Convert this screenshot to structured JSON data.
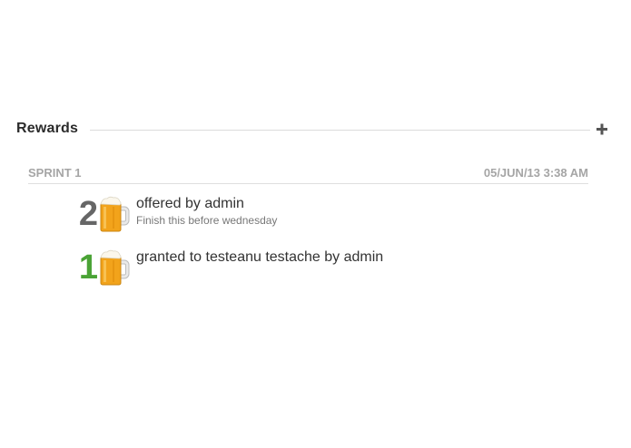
{
  "section": {
    "title": "Rewards",
    "add_icon": "plus-icon"
  },
  "group": {
    "name": "SPRINT 1",
    "timestamp": "05/JUN/13 3:38 AM"
  },
  "rewards": [
    {
      "count": "2",
      "count_color": "#666666",
      "icon": "beer-mug-icon",
      "title": "offered by admin",
      "note": "Finish this before wednesday"
    },
    {
      "count": "1",
      "count_color": "#4aa335",
      "icon": "beer-mug-icon",
      "title": "granted to testeanu testache by admin",
      "note": ""
    }
  ],
  "colors": {
    "beer": "#f2a31b",
    "foam": "#fbf7ec",
    "rule": "#dcdcdc",
    "muted_text": "#a5a5a5"
  }
}
